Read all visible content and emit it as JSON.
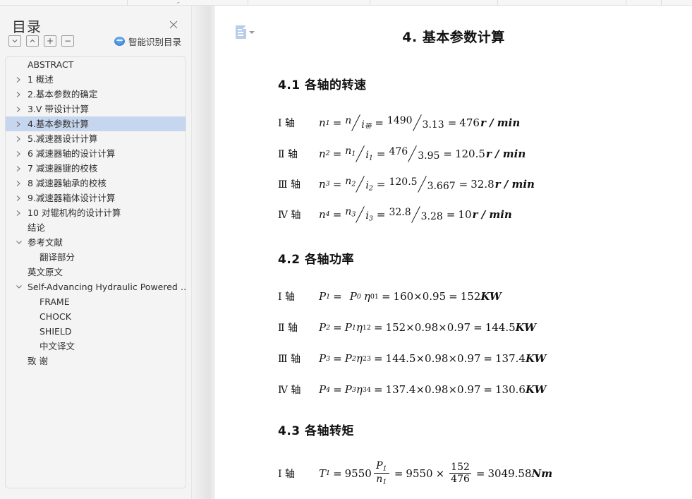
{
  "window": {
    "top_strip_glyph": "⌐"
  },
  "sidebar": {
    "title": "目录",
    "close_label": "×",
    "toolbar": {
      "collapse_all_label": "⌄",
      "expand_all_label": "⌃",
      "zoom_in_label": "+",
      "zoom_out_label": "−",
      "smart_outline_label": "智能识别目录"
    },
    "items": [
      {
        "label": "ABSTRACT",
        "level": 0,
        "caret": "none",
        "selected": false
      },
      {
        "label": "1 概述",
        "level": 0,
        "caret": "right",
        "selected": false
      },
      {
        "label": "2.基本参数的确定",
        "level": 0,
        "caret": "right",
        "selected": false
      },
      {
        "label": "3.V 带设计计算",
        "level": 0,
        "caret": "right",
        "selected": false
      },
      {
        "label": "4.基本参数计算",
        "level": 0,
        "caret": "right",
        "selected": true
      },
      {
        "label": "5.减速器设计计算",
        "level": 0,
        "caret": "right",
        "selected": false
      },
      {
        "label": "6 减速器轴的设计计算",
        "level": 0,
        "caret": "right",
        "selected": false
      },
      {
        "label": "7 减速器键的校核",
        "level": 0,
        "caret": "right",
        "selected": false
      },
      {
        "label": "8 减速器轴承的校核",
        "level": 0,
        "caret": "right",
        "selected": false
      },
      {
        "label": "9.减速器箱体设计计算",
        "level": 0,
        "caret": "right",
        "selected": false
      },
      {
        "label": "10 对辊机构的设计计算",
        "level": 0,
        "caret": "right",
        "selected": false
      },
      {
        "label": "结论",
        "level": 0,
        "caret": "none",
        "selected": false
      },
      {
        "label": "参考文献",
        "level": 0,
        "caret": "down",
        "selected": false
      },
      {
        "label": "翻译部分",
        "level": 1,
        "caret": "none",
        "selected": false
      },
      {
        "label": "英文原文",
        "level": 0,
        "caret": "none",
        "selected": false
      },
      {
        "label": "Self-Advancing Hydraulic Powered  …",
        "level": 0,
        "caret": "down",
        "selected": false
      },
      {
        "label": "FRAME",
        "level": 1,
        "caret": "none",
        "selected": false
      },
      {
        "label": "CHOCK",
        "level": 1,
        "caret": "none",
        "selected": false
      },
      {
        "label": "SHIELD",
        "level": 1,
        "caret": "none",
        "selected": false
      },
      {
        "label": "中文译文",
        "level": 1,
        "caret": "none",
        "selected": false
      },
      {
        "label": "致    谢",
        "level": 0,
        "caret": "none",
        "selected": false
      }
    ]
  },
  "document": {
    "page_icon_name": "document-outline-icon",
    "title": "4. 基本参数计算",
    "sections": [
      {
        "heading": "4.1 各轴的转速"
      },
      {
        "heading": "4.2 各轴功率"
      },
      {
        "heading": "4.3 各轴转矩"
      }
    ],
    "speed_equations": [
      {
        "shaft": "Ⅰ 轴",
        "lhs_var": "n",
        "lhs_sub": "1",
        "num1_var": "n",
        "num1_sub": "",
        "den1_var": "i",
        "den1_sub": "带",
        "num2": "1490",
        "den2": "3.13",
        "result": "476",
        "unit": "r / min"
      },
      {
        "shaft": "Ⅱ 轴",
        "lhs_var": "n",
        "lhs_sub": "2",
        "num1_var": "n",
        "num1_sub": "1",
        "den1_var": "i",
        "den1_sub": "1",
        "num2": "476",
        "den2": "3.95",
        "result": "120.5",
        "unit": "r / min"
      },
      {
        "shaft": "Ⅲ 轴",
        "lhs_var": "n",
        "lhs_sub": "3",
        "num1_var": "n",
        "num1_sub": "2",
        "den1_var": "i",
        "den1_sub": "2",
        "num2": "120.5",
        "den2": "3.667",
        "result": "32.8",
        "unit": "r / min"
      },
      {
        "shaft": "Ⅳ 轴",
        "lhs_var": "n",
        "lhs_sub": "4",
        "num1_var": "n",
        "num1_sub": "3",
        "den1_var": "i",
        "den1_sub": "3",
        "num2": "32.8",
        "den2": "3.28",
        "result": "10",
        "unit": "r / min"
      }
    ],
    "power_equations": [
      {
        "shaft": "Ⅰ 轴",
        "lhs_var": "P",
        "lhs_sub": "1",
        "term1_var": "P",
        "term1_sub": "0",
        "eta_sub": "01",
        "values": "160×0.95",
        "result": "152",
        "unit": "KW"
      },
      {
        "shaft": "Ⅱ 轴",
        "lhs_var": "P",
        "lhs_sub": "2",
        "term1_var": "P",
        "term1_sub": "1",
        "eta_sub": "12",
        "values": "152×0.98×0.97",
        "result": "144.5",
        "unit": "KW"
      },
      {
        "shaft": "Ⅲ 轴",
        "lhs_var": "P",
        "lhs_sub": "3",
        "term1_var": "P",
        "term1_sub": "2",
        "eta_sub": "23",
        "values": "144.5×0.98×0.97",
        "result": "137.4",
        "unit": "KW"
      },
      {
        "shaft": "Ⅳ 轴",
        "lhs_var": "P",
        "lhs_sub": "4",
        "term1_var": "P",
        "term1_sub": "3",
        "eta_sub": "34",
        "values": "137.4×0.98×0.97",
        "result": "130.6",
        "unit": "KW"
      }
    ],
    "torque_equations": [
      {
        "shaft": "Ⅰ 轴",
        "lhs_var": "T",
        "lhs_sub": "1",
        "coeff": "9550",
        "frac_top_var": "P",
        "frac_top_sub": "1",
        "frac_bot_var": "n",
        "frac_bot_sub": "1",
        "coeff2": "9550",
        "num": "152",
        "den": "476",
        "result": "3049.58",
        "unit": "Nm"
      }
    ]
  }
}
